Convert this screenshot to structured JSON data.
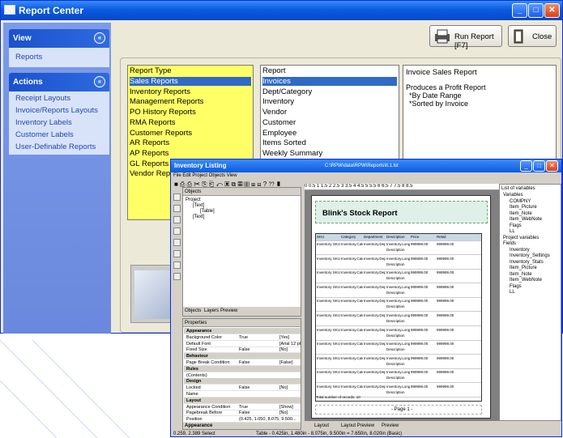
{
  "window": {
    "title": "Report Center",
    "minimize": "_",
    "maximize": "□",
    "close": "✕"
  },
  "sidebar": {
    "view": {
      "header": "View",
      "toggle": "«",
      "items": [
        {
          "label": "Reports"
        }
      ]
    },
    "actions": {
      "header": "Actions",
      "toggle": "«",
      "items": [
        {
          "label": "Receipt Layouts"
        },
        {
          "label": "Invoice/Reports Layouts"
        },
        {
          "label": "Inventory Labels"
        },
        {
          "label": "Customer Labels"
        },
        {
          "label": "User-Definable Reports"
        }
      ]
    }
  },
  "toolbar": {
    "run_report": "Run Report [F7]",
    "close": "Close"
  },
  "report_type": {
    "header": "Report Type",
    "items": [
      "Sales Reports",
      "Inventory Reports",
      "Management Reports",
      "PO History Reports",
      "RMA Reports",
      "Customer Reports",
      "AR Reports",
      "AP Reports",
      "GL Reports",
      "Vendor Reports"
    ],
    "selected": 0
  },
  "report": {
    "header": "Report",
    "items": [
      "Invoices",
      "Dept/Category",
      "Inventory",
      "Vendor",
      "Customer",
      "Employee",
      "Items Sorted",
      "Weekly Summary"
    ],
    "selected": 0
  },
  "description": {
    "title": "Invoice Sales Report",
    "line1": "Produces a Profit Report",
    "line2": "*By Date Range",
    "line3": "*Sorted by Invoice"
  },
  "designer": {
    "title": "Inventory Listing",
    "path": "C:\\RPW\\data\\RPW\\Reports\\lt.1.lst",
    "menu": "File  Edit  Project  Objects  View",
    "objects_header": "Objects",
    "tree": [
      "Project",
      "[Text]",
      "[Table]",
      "[Text]"
    ],
    "tabs": [
      "Objects",
      "Layers",
      "Preview"
    ],
    "properties_header": "Properties",
    "props": [
      {
        "k": "Appearance",
        "v": "",
        "v2": "",
        "sec": true
      },
      {
        "k": "Background Color",
        "v": "True",
        "v2": "[Yes]"
      },
      {
        "k": "Default Font",
        "v": "",
        "v2": "[Arial 12 pt]"
      },
      {
        "k": "Fixed Size",
        "v": "False",
        "v2": "[No]"
      },
      {
        "k": "Behaviour",
        "v": "",
        "v2": "",
        "sec": true
      },
      {
        "k": "Page Break Condition",
        "v": "False",
        "v2": "[False]"
      },
      {
        "k": "Rules",
        "v": "",
        "v2": "",
        "sec": true
      },
      {
        "k": "(Contents)",
        "v": "",
        "v2": ""
      },
      {
        "k": "Design",
        "v": "",
        "v2": "",
        "sec": true
      },
      {
        "k": "Locked",
        "v": "False",
        "v2": "[No]"
      },
      {
        "k": "Name",
        "v": "",
        "v2": ""
      },
      {
        "k": "Layout",
        "v": "",
        "v2": "",
        "sec": true
      },
      {
        "k": "Appearance Condition",
        "v": "True",
        "v2": "[Show]"
      },
      {
        "k": "Pagebreak Before",
        "v": "False",
        "v2": "[No]"
      },
      {
        "k": "Position",
        "v": "(0.425, 1.050, 8.075, 9.500...",
        "v2": ""
      }
    ],
    "props_footer": "Appearance",
    "ruler": "0    0.5    1    1.5    2    2.5    3    3.5    4    4.5    5    5.5    6    6.5    7    7.5    8    8.5",
    "report_title": "Blink's Stock Report",
    "columns": [
      "SKU",
      "Category",
      "Department",
      "Description",
      "Price",
      "Retail"
    ],
    "row": [
      "Inventory SKU",
      "Inventory.Category",
      "Inventory.Depar",
      "Inventory.Long",
      "999999.00",
      "999999.00"
    ],
    "row_desc": "Description",
    "total": "Total number of records: 10",
    "page_label": "- Page 1 -",
    "bottom_tabs": [
      "Layout",
      "Layout Preview",
      "Preview"
    ],
    "status_left": "0.259, 2.389  Select",
    "status_right": "Table - 0.425in, 1.480in - 8.075in, 9.500in = 7.650in, 8.020in (Basic)",
    "vars_header": "List of variables",
    "vars": [
      "Variables",
      "COMPNY",
      "Item_Picture",
      "Item_Note",
      "Item_WebNote",
      "Flags",
      "LL",
      "Project variables",
      "Fields",
      "Inventory",
      "Inventory_Settings",
      "Inventory_Stats",
      "Item_Picture",
      "Item_Note",
      "Item_WebNote",
      "Flags",
      "LL"
    ]
  },
  "colors": {
    "accent": "#316ac5",
    "yellow": "#ffff66",
    "title_band": "#0a5be0"
  }
}
